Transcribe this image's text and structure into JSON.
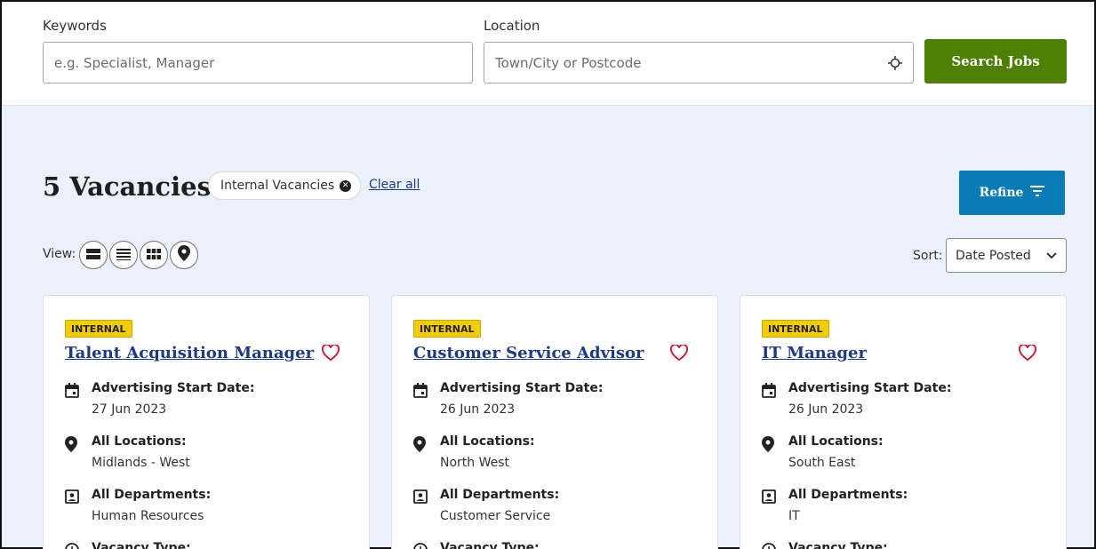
{
  "search": {
    "keywords_label": "Keywords",
    "keywords_placeholder": "e.g. Specialist, Manager",
    "location_label": "Location",
    "location_placeholder": "Town/City or Postcode",
    "button_label": "Search Jobs"
  },
  "results": {
    "count_label": "5 Vacancies",
    "filter_chip": "Internal Vacancies",
    "clear_all": "Clear all",
    "refine_label": "Refine",
    "view_label": "View:",
    "sort_label": "Sort:",
    "sort_value": "Date Posted"
  },
  "colors": {
    "search_button": "#4f7f05",
    "refine_button": "#0a7bb6",
    "badge": "#f4cd00",
    "link": "#1d3a8a",
    "background": "#eaf1fb"
  },
  "jobs": [
    {
      "badge": "INTERNAL",
      "title": "Talent Acquisition Manager",
      "start_label": "Advertising Start Date:",
      "start_date": "27 Jun 2023",
      "location_label": "All Locations:",
      "location": "Midlands - West",
      "department_label": "All Departments:",
      "department": "Human Resources",
      "type_label": "Vacancy Type:"
    },
    {
      "badge": "INTERNAL",
      "title": "Customer Service Advisor",
      "start_label": "Advertising Start Date:",
      "start_date": "26 Jun 2023",
      "location_label": "All Locations:",
      "location": "North West",
      "department_label": "All Departments:",
      "department": "Customer Service",
      "type_label": "Vacancy Type:"
    },
    {
      "badge": "INTERNAL",
      "title": "IT Manager",
      "start_label": "Advertising Start Date:",
      "start_date": "26 Jun 2023",
      "location_label": "All Locations:",
      "location": "South East",
      "department_label": "All Departments:",
      "department": "IT",
      "type_label": "Vacancy Type:"
    }
  ]
}
